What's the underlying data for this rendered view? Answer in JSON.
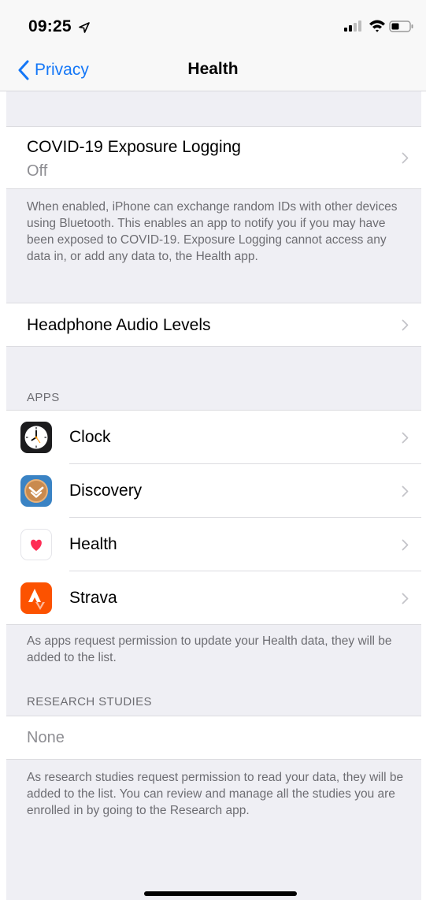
{
  "status_bar": {
    "time": "09:25",
    "location_icon": "location-arrow-icon",
    "signal_icon": "cellular-signal-icon",
    "wifi_icon": "wifi-icon",
    "battery_icon": "battery-icon"
  },
  "nav": {
    "back_label": "Privacy",
    "title": "Health",
    "accent_color": "#1477f7"
  },
  "exposure_logging": {
    "title": "COVID-19 Exposure Logging",
    "value": "Off",
    "footer": "When enabled, iPhone can exchange random IDs with other devices using Bluetooth. This enables an app to notify you if you may have been exposed to COVID-19. Exposure Logging cannot access any data in, or add any data to, the Health app."
  },
  "headphone": {
    "title": "Headphone Audio Levels"
  },
  "apps": {
    "header": "APPS",
    "items": [
      {
        "label": "Clock",
        "icon": "clock-icon"
      },
      {
        "label": "Discovery",
        "icon": "discovery-icon"
      },
      {
        "label": "Health",
        "icon": "health-heart-icon"
      },
      {
        "label": "Strava",
        "icon": "strava-icon"
      }
    ],
    "footer": "As apps request permission to update your Health data, they will be added to the list."
  },
  "research": {
    "header": "RESEARCH STUDIES",
    "none_label": "None",
    "footer": "As research studies request permission to read your data, they will be added to the list. You can review and manage all the studies you are enrolled in by going to the Research app."
  }
}
